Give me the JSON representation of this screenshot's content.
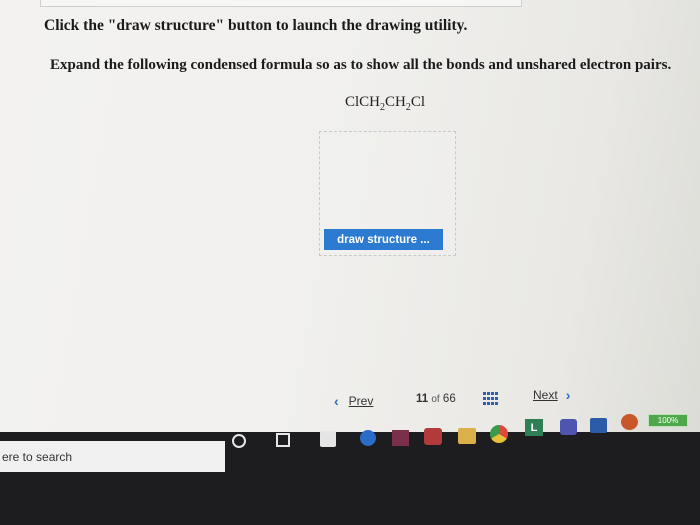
{
  "question": {
    "instruction": "Click the \"draw structure\" button to launch the drawing utility.",
    "prompt": "Expand the following condensed formula so as to show all the bonds and unshared electron pairs.",
    "formula_main": "ClCH",
    "formula_sub1": "2",
    "formula_mid": "CH",
    "formula_sub2": "2",
    "formula_end": "Cl"
  },
  "draw_button": {
    "label": "draw structure ...",
    "color": "#2d7bd0"
  },
  "navigation": {
    "prev_label": "Prev",
    "next_label": "Next",
    "current": "11",
    "of_label": "of",
    "total": "66"
  },
  "taskbar": {
    "search_placeholder": "ere to search",
    "icons": [
      "cortana-icon",
      "task-view-icon",
      "store-icon",
      "blue-app-icon",
      "purple-app-icon",
      "mail-icon",
      "file-explorer-icon",
      "chrome-icon",
      "l-app-icon",
      "teams-icon",
      "word-icon",
      "orange-app-icon"
    ],
    "l_app_letter": "L",
    "battery_label": "100%"
  }
}
